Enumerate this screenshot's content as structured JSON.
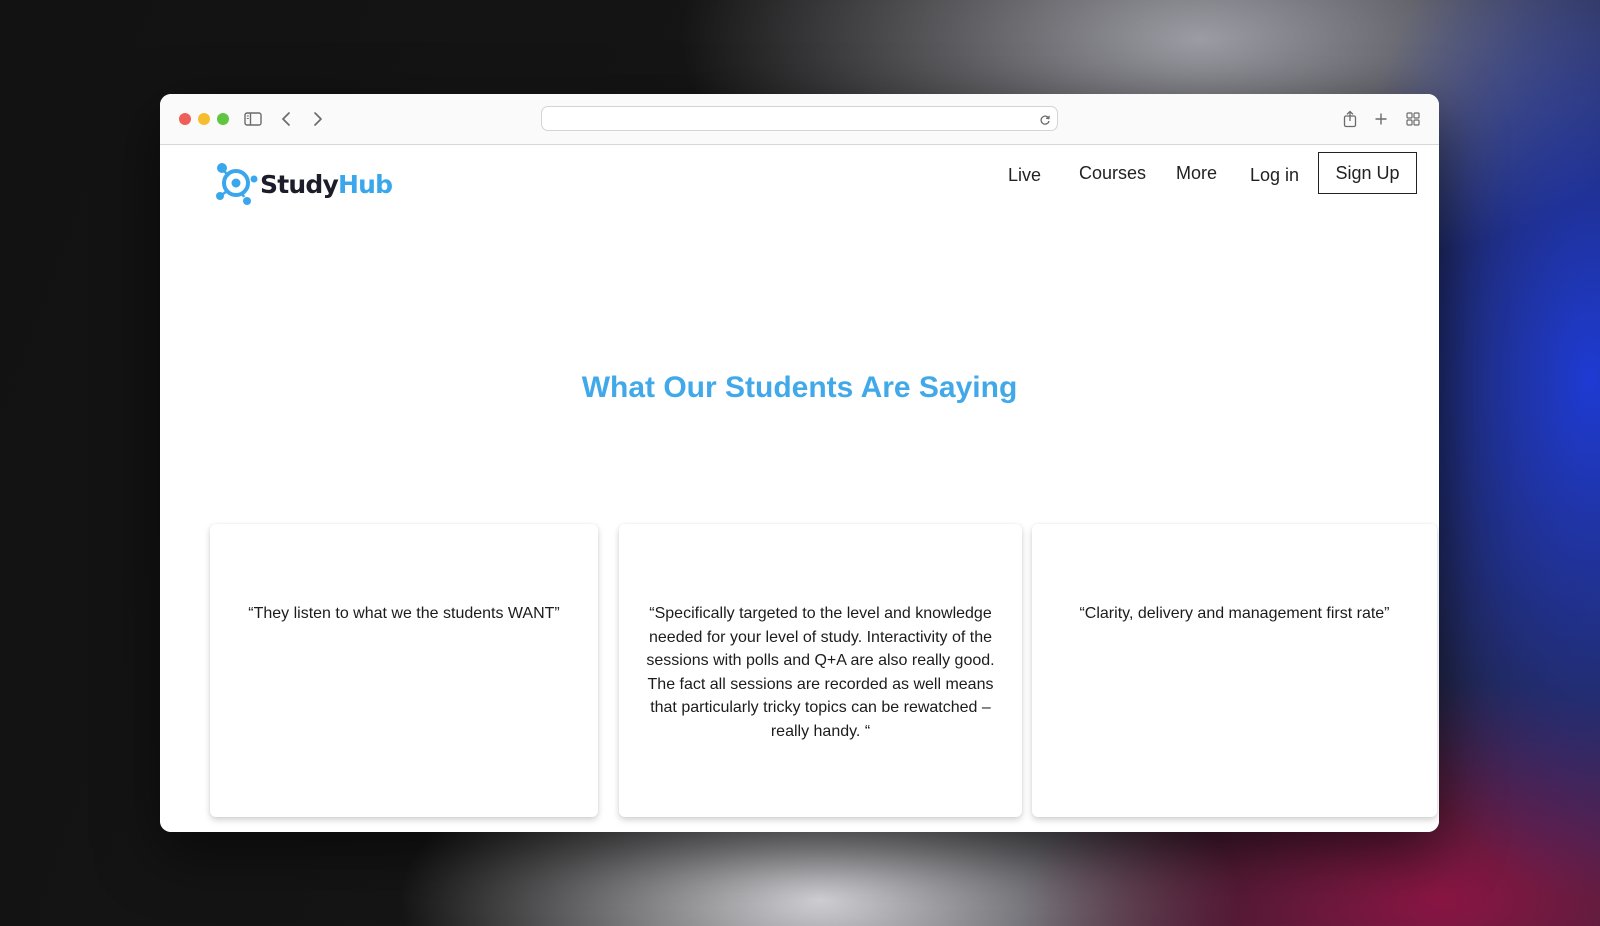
{
  "brand": {
    "name_part1": "Study",
    "name_part2": "Hub",
    "accent_color": "#3aa7ec",
    "logo_icon": "connected-nodes-logo-icon"
  },
  "browser": {
    "address_value": "",
    "icons": [
      "sidebar-icon",
      "back-icon",
      "forward-icon",
      "reload-icon",
      "share-icon",
      "new-tab-icon",
      "tab-overview-icon"
    ]
  },
  "nav": {
    "live": "Live",
    "courses": "Courses",
    "more": "More",
    "login": "Log in",
    "signup": "Sign Up"
  },
  "testimonials": {
    "heading": "What Our Students Are Saying",
    "heading_color": "#41a9e9",
    "items": [
      {
        "quote": "“They listen to what we the students WANT”"
      },
      {
        "quote": "“Specifically targeted to the level and knowledge needed for your level of study. Interactivity of the sessions with polls and Q+A are also really good. The fact all sessions are recorded as well means that particularly tricky topics can be rewatched – really handy. “"
      },
      {
        "quote": "“Clarity, delivery and management first rate”"
      }
    ]
  }
}
